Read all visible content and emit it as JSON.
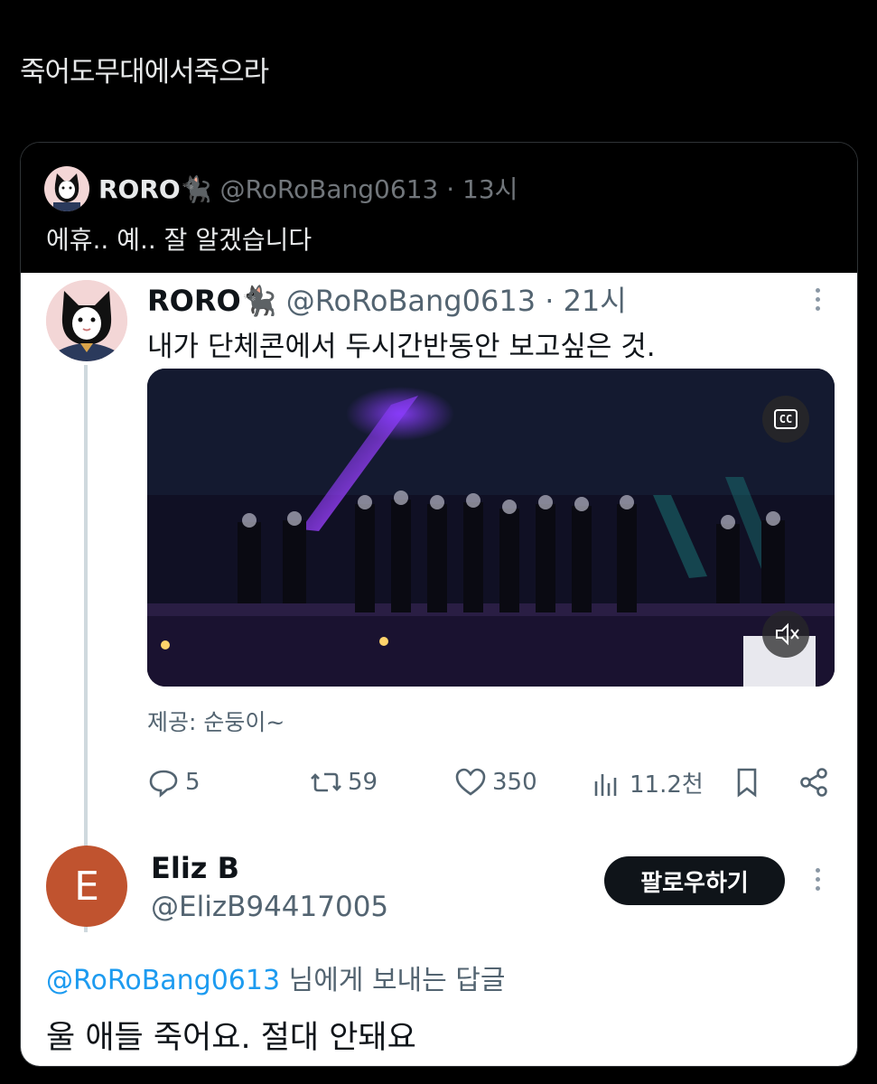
{
  "top_text": "죽어도무대에서죽으라",
  "quoted": {
    "name": "RORO",
    "name_emoji": "🐈‍⬛",
    "handle": "@RoRoBang0613",
    "time": "· 13시",
    "text": "에휴.. 예.. 잘 알겠습니다"
  },
  "original": {
    "name": "RORO",
    "name_emoji": "🐈‍⬛",
    "handle": "@RoRoBang0613",
    "time": "· 21시",
    "text": "내가 단체콘에서 두시간반동안 보고싶은 것.",
    "cc_label": "CC",
    "credit": "제공: 순둥이~",
    "stats": {
      "replies": "5",
      "reposts": "59",
      "likes": "350",
      "views": "11.2천"
    }
  },
  "reply": {
    "avatar_letter": "E",
    "name": "Eliz B",
    "handle": "@ElizB94417005",
    "follow_label": "팔로우하기",
    "replying_to_handle": "@RoRoBang0613",
    "replying_to_suffix": " 님에게 보내는 답글",
    "text": "울 애들 죽어요. 절대 안돼요"
  }
}
